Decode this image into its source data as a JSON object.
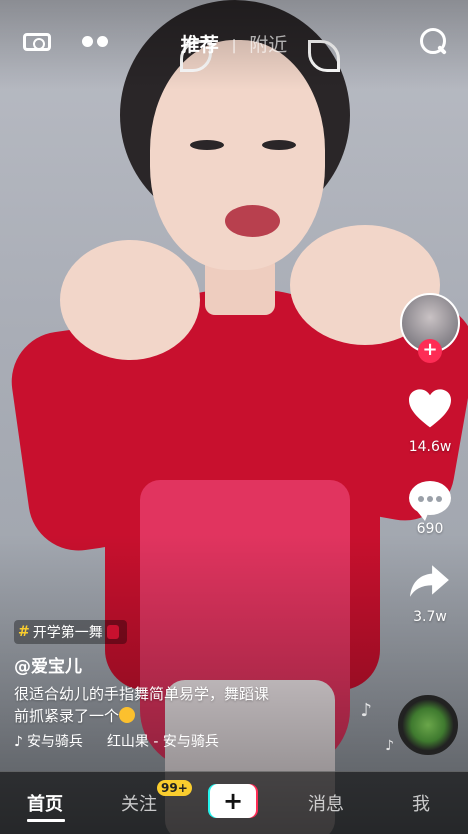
{
  "top_tabs": {
    "recommend": "推荐",
    "nearby": "附近"
  },
  "actions": {
    "likes": "14.6w",
    "comments": "690",
    "shares": "3.7w"
  },
  "caption": {
    "hashtag": "开学第一舞",
    "username": "@爱宝儿",
    "line1": "很适合幼儿的手指舞简单易学，舞蹈课",
    "line2": "前抓紧录了一个",
    "music_artist": "安与骑兵",
    "music_song": "红山果 - 安与骑兵"
  },
  "bottom_nav": {
    "home": "首页",
    "follow": "关注",
    "follow_badge": "99+",
    "create": "+",
    "messages": "消息",
    "me": "我"
  },
  "colors": {
    "accent_red": "#fe2c55",
    "accent_cyan": "#25f4ee",
    "badge_yellow": "#facd2e"
  },
  "icons": {
    "top_left": "camera-icon",
    "top_left_2": "dual-dot-icon",
    "top_right": "search-icon",
    "like": "heart-icon",
    "comment": "comment-icon",
    "share": "share-arrow-icon",
    "music": "music-disc-icon"
  }
}
